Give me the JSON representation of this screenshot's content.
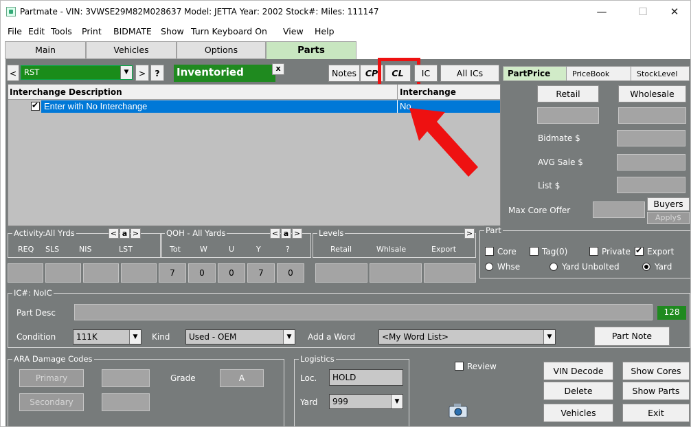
{
  "window": {
    "title": "Partmate - VIN: 3VWSE29M82M028637   Model: JETTA   Year: 2002   Stock#:   Miles: 111147",
    "minimize": "—",
    "maximize": "☐",
    "close": "✕"
  },
  "menu": [
    "File",
    "Edit",
    "Tools",
    "Print",
    "BIDMATE",
    "Show",
    "Turn Keyboard On",
    "View",
    "Help"
  ],
  "tabs": [
    "Main",
    "Vehicles",
    "Options",
    "Parts"
  ],
  "toolbar": {
    "prev": "<",
    "part_value": "RST",
    "next": ">",
    "help": "?",
    "status": "Inventoried",
    "status_close": "x",
    "notes": "Notes",
    "cp": "CP",
    "cl": "CL",
    "ic": "IC",
    "all_ics": "All ICs"
  },
  "grid": {
    "col1": "Interchange Description",
    "col2": "Interchange",
    "row_desc": "Enter with No Interchange",
    "row_ic": "No"
  },
  "price_tabs": [
    "PartPrice",
    "PriceBook",
    "StockLevel"
  ],
  "price": {
    "retail": "Retail",
    "wholesale": "Wholesale",
    "bidmate": "Bidmate $",
    "avg_sale": "AVG Sale $",
    "list": "List $",
    "max_core": "Max Core Offer",
    "buyers": "Buyers",
    "apply": "Apply$"
  },
  "activity": {
    "title": "Activity:All Yrds",
    "cols": [
      "REQ",
      "SLS",
      "NIS",
      "LST"
    ],
    "lt": "<",
    "a": "a",
    "gt": ">"
  },
  "qoh": {
    "title": "QOH - All Yards",
    "cols": [
      "Tot",
      "W",
      "U",
      "Y",
      "?"
    ],
    "values": [
      "7",
      "0",
      "0",
      "7",
      "0"
    ],
    "lt": "<",
    "a": "a",
    "gt": ">"
  },
  "levels": {
    "title": "Levels",
    "cols": [
      "Retail",
      "Whlsale",
      "Export"
    ],
    "gt": ">"
  },
  "part": {
    "title": "Part",
    "core": "Core",
    "tag": "Tag(0)",
    "private": "Private",
    "export": "Export",
    "whse": "Whse",
    "yard_unbolted": "Yard Unbolted",
    "yard": "Yard"
  },
  "ic": {
    "title": "IC#: NoIC",
    "part_desc": "Part Desc",
    "count": "128",
    "condition": "Condition",
    "condition_value": "111K",
    "kind": "Kind",
    "kind_value": "Used - OEM",
    "add_word": "Add a Word",
    "word_value": "<My Word List>",
    "part_note": "Part Note"
  },
  "ara": {
    "title": "ARA Damage Codes",
    "primary": "Primary",
    "secondary": "Secondary",
    "grade": "Grade",
    "grade_value": "A"
  },
  "logistics": {
    "title": "Logistics",
    "loc": "Loc.",
    "loc_value": "HOLD",
    "yard": "Yard",
    "yard_value": "999"
  },
  "review": "Review",
  "actions": {
    "vin_decode": "VIN Decode",
    "show_cores": "Show Cores",
    "delete": "Delete",
    "show_parts": "Show Parts",
    "vehicles": "Vehicles",
    "exit": "Exit"
  },
  "colors": {
    "panel": "#777b7b",
    "grid": "#c0c0c0",
    "selection": "#0078d7",
    "status_green": "#1f8a1f",
    "annotation_red": "#ee1111"
  }
}
